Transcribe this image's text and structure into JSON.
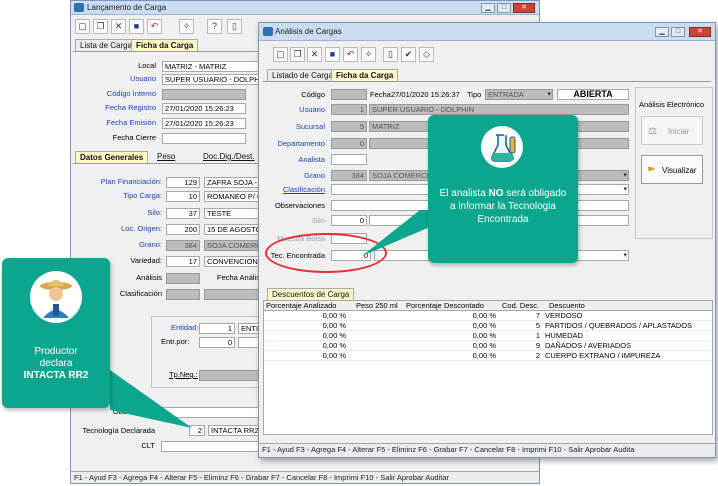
{
  "main_window": {
    "title": "Lançamento de Carga",
    "tabs": [
      "Lista de Cargas",
      "Ficha da Carga"
    ],
    "header_fields": {
      "local_label": "Local",
      "local_value": "MATRIZ - MATRIZ",
      "usuario_label": "Usuario",
      "usuario_value": "SUPER USUARIO - DOLPHIN",
      "codigo_interno_label": "Código Interno",
      "fecha_registro_label": "Fecha Registro",
      "fecha_registro_value": "27/01/2020 15:26:23",
      "fecha_emision_label": "Fecha Emisión",
      "fecha_emision_value": "27/01/2020 15:26:23",
      "fecha_cierre_label": "Fecha Cierre"
    },
    "subtabs": [
      "Datos Generales",
      "Peso",
      "Doc.Dig./Dest."
    ],
    "general": {
      "plan_label": "Plan Financiación:",
      "plan_code": "129",
      "plan_name": "ZAFRA SOJA - 2",
      "tipo_label": "Tipo Carga:",
      "tipo_code": "10",
      "tipo_name": "ROMANEO P/ CO",
      "silo_label": "Silo:",
      "silo_code": "37",
      "silo_name": "TESTE",
      "loc_label": "Loc. Origen:",
      "loc_code": "200",
      "loc_name": "15 DE AGOSTO",
      "grano_label": "Grano:",
      "grano_code": "384",
      "grano_name": "SOJA COMERCI",
      "variedad_label": "Variedad:",
      "variedad_code": "17",
      "variedad_name": "CONVENCIONA",
      "analisis_label": "Análisis",
      "fecha_analisis_label": "Fecha Análisis:",
      "clasificacion_label": "Clasificación"
    },
    "entidad": {
      "entidad_label": "Entidad:",
      "entidad_value": "1",
      "entidad_name": "ENTI",
      "entr_label": "Entr.por:",
      "entr_value": "0",
      "tp_label": "Tp.Neg.:"
    },
    "bottom": {
      "obs_label": "Observación",
      "tec_label": "Tecnología Declarada",
      "tec_code": "2",
      "tec_name": "INTACTA RR2",
      "clt_label": "CLT"
    },
    "status": "F1 - Ayud          F3 - Agrega  F4 - Alterar  F5 - Eliminz  F6 - Grabar  F7 - Cancelar  F8 - Imprimi  F10 - Salir Aprobar      Auditar"
  },
  "analysis_window": {
    "title": "Análisis de Cargas",
    "tabs": [
      "Listado de Cargas",
      "Ficha da Carga"
    ],
    "codigo_label": "Código",
    "fecha_label": "Fecha",
    "fecha_value": "27/01/2020 15:26:37",
    "tipo_label": "Tipo",
    "tipo_value": "ENTRADA",
    "estado": "ABIERTA",
    "usuario_label": "Usuario",
    "usuario_code": "1",
    "usuario_name": "SUPER USUARIO - DOLPHIN",
    "sucursal_label": "Sucursal",
    "sucursal_code": "5",
    "sucursal_name": "MATRIZ",
    "departamento_label": "Departamento",
    "departamento_code": "0",
    "analista_label": "Analista",
    "grano_label": "Grano",
    "grano_code": "384",
    "grano_name": "SOJA COMERCIAL",
    "clasificacion_label": "Clasificación",
    "observaciones_label": "Observaciones",
    "silo_label": "Silo",
    "silo_code": "0",
    "muestra_label": "Muestra Bolsa",
    "tec_label": "Tec. Encontrada",
    "tec_code": "0",
    "electronic_title": "Análisis Electrónico",
    "btn_iniciar": "Iniciar",
    "btn_visualizar": "Visualizar",
    "discount_tab": "Descuentos de Carga",
    "columns": [
      "Porcentaje Analizado",
      "Peso 250 ml",
      "Porcentaje Descontado",
      "Cod. Desc.",
      "Descuento"
    ],
    "rows": [
      {
        "analizado": "0,00 %",
        "peso": "",
        "descontado": "0,00 %",
        "cod": "7",
        "desc": "VERDOSO"
      },
      {
        "analizado": "0,00 %",
        "peso": "",
        "descontado": "0,00 %",
        "cod": "5",
        "desc": "PARTIDOS / QUEBRADOS / APLASTADOS"
      },
      {
        "analizado": "0,00 %",
        "peso": "",
        "descontado": "0,00 %",
        "cod": "1",
        "desc": "HUMEDAD"
      },
      {
        "analizado": "0,00 %",
        "peso": "",
        "descontado": "0,00 %",
        "cod": "9",
        "desc": "DAÑADOS / AVERIADOS"
      },
      {
        "analizado": "0,00 %",
        "peso": "",
        "descontado": "0,00 %",
        "cod": "2",
        "desc": "CUERPO EXTRANO / IMPUREZA"
      }
    ],
    "status": "F1 - Ayud              F3 - Agrega  F4 - Alterar  F5 - Eliminz  F6 - Grabar  F7 - Cancelar  F8 - Imprimi  F10 - Salir Aprobar      Audita"
  },
  "callout_analyst": {
    "pre": "El analista ",
    "bold": "NO",
    "post": " será obligado a informar la Tecnologia Encontrada"
  },
  "callout_producer": {
    "line1": "Productor",
    "line2": "declara",
    "line3": "INTACTA RR2"
  },
  "colors": {
    "callout": "#0ca68e",
    "highlight": "#e03030",
    "label_blue": "#1a44b0"
  }
}
